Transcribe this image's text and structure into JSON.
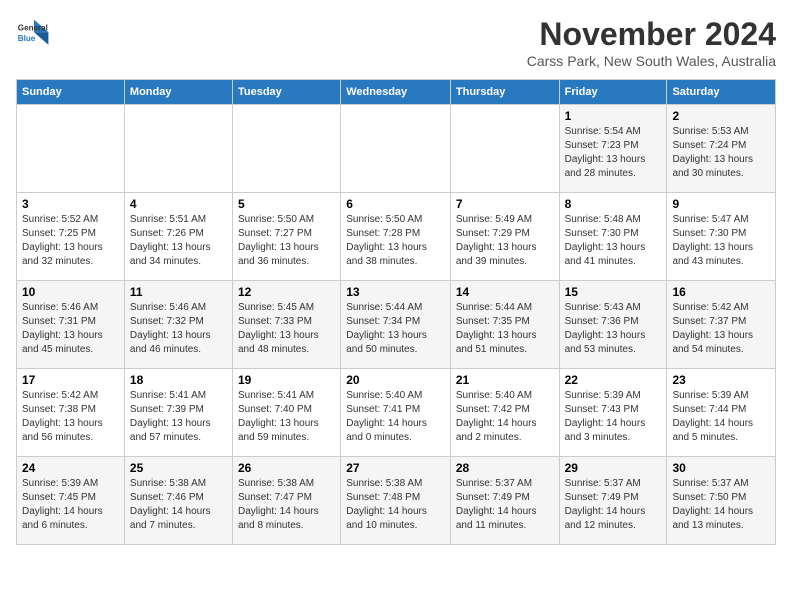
{
  "logo": {
    "line1": "General",
    "line2": "Blue"
  },
  "title": "November 2024",
  "subtitle": "Carss Park, New South Wales, Australia",
  "weekdays": [
    "Sunday",
    "Monday",
    "Tuesday",
    "Wednesday",
    "Thursday",
    "Friday",
    "Saturday"
  ],
  "weeks": [
    [
      {
        "day": "",
        "info": ""
      },
      {
        "day": "",
        "info": ""
      },
      {
        "day": "",
        "info": ""
      },
      {
        "day": "",
        "info": ""
      },
      {
        "day": "",
        "info": ""
      },
      {
        "day": "1",
        "info": "Sunrise: 5:54 AM\nSunset: 7:23 PM\nDaylight: 13 hours\nand 28 minutes."
      },
      {
        "day": "2",
        "info": "Sunrise: 5:53 AM\nSunset: 7:24 PM\nDaylight: 13 hours\nand 30 minutes."
      }
    ],
    [
      {
        "day": "3",
        "info": "Sunrise: 5:52 AM\nSunset: 7:25 PM\nDaylight: 13 hours\nand 32 minutes."
      },
      {
        "day": "4",
        "info": "Sunrise: 5:51 AM\nSunset: 7:26 PM\nDaylight: 13 hours\nand 34 minutes."
      },
      {
        "day": "5",
        "info": "Sunrise: 5:50 AM\nSunset: 7:27 PM\nDaylight: 13 hours\nand 36 minutes."
      },
      {
        "day": "6",
        "info": "Sunrise: 5:50 AM\nSunset: 7:28 PM\nDaylight: 13 hours\nand 38 minutes."
      },
      {
        "day": "7",
        "info": "Sunrise: 5:49 AM\nSunset: 7:29 PM\nDaylight: 13 hours\nand 39 minutes."
      },
      {
        "day": "8",
        "info": "Sunrise: 5:48 AM\nSunset: 7:30 PM\nDaylight: 13 hours\nand 41 minutes."
      },
      {
        "day": "9",
        "info": "Sunrise: 5:47 AM\nSunset: 7:30 PM\nDaylight: 13 hours\nand 43 minutes."
      }
    ],
    [
      {
        "day": "10",
        "info": "Sunrise: 5:46 AM\nSunset: 7:31 PM\nDaylight: 13 hours\nand 45 minutes."
      },
      {
        "day": "11",
        "info": "Sunrise: 5:46 AM\nSunset: 7:32 PM\nDaylight: 13 hours\nand 46 minutes."
      },
      {
        "day": "12",
        "info": "Sunrise: 5:45 AM\nSunset: 7:33 PM\nDaylight: 13 hours\nand 48 minutes."
      },
      {
        "day": "13",
        "info": "Sunrise: 5:44 AM\nSunset: 7:34 PM\nDaylight: 13 hours\nand 50 minutes."
      },
      {
        "day": "14",
        "info": "Sunrise: 5:44 AM\nSunset: 7:35 PM\nDaylight: 13 hours\nand 51 minutes."
      },
      {
        "day": "15",
        "info": "Sunrise: 5:43 AM\nSunset: 7:36 PM\nDaylight: 13 hours\nand 53 minutes."
      },
      {
        "day": "16",
        "info": "Sunrise: 5:42 AM\nSunset: 7:37 PM\nDaylight: 13 hours\nand 54 minutes."
      }
    ],
    [
      {
        "day": "17",
        "info": "Sunrise: 5:42 AM\nSunset: 7:38 PM\nDaylight: 13 hours\nand 56 minutes."
      },
      {
        "day": "18",
        "info": "Sunrise: 5:41 AM\nSunset: 7:39 PM\nDaylight: 13 hours\nand 57 minutes."
      },
      {
        "day": "19",
        "info": "Sunrise: 5:41 AM\nSunset: 7:40 PM\nDaylight: 13 hours\nand 59 minutes."
      },
      {
        "day": "20",
        "info": "Sunrise: 5:40 AM\nSunset: 7:41 PM\nDaylight: 14 hours\nand 0 minutes."
      },
      {
        "day": "21",
        "info": "Sunrise: 5:40 AM\nSunset: 7:42 PM\nDaylight: 14 hours\nand 2 minutes."
      },
      {
        "day": "22",
        "info": "Sunrise: 5:39 AM\nSunset: 7:43 PM\nDaylight: 14 hours\nand 3 minutes."
      },
      {
        "day": "23",
        "info": "Sunrise: 5:39 AM\nSunset: 7:44 PM\nDaylight: 14 hours\nand 5 minutes."
      }
    ],
    [
      {
        "day": "24",
        "info": "Sunrise: 5:39 AM\nSunset: 7:45 PM\nDaylight: 14 hours\nand 6 minutes."
      },
      {
        "day": "25",
        "info": "Sunrise: 5:38 AM\nSunset: 7:46 PM\nDaylight: 14 hours\nand 7 minutes."
      },
      {
        "day": "26",
        "info": "Sunrise: 5:38 AM\nSunset: 7:47 PM\nDaylight: 14 hours\nand 8 minutes."
      },
      {
        "day": "27",
        "info": "Sunrise: 5:38 AM\nSunset: 7:48 PM\nDaylight: 14 hours\nand 10 minutes."
      },
      {
        "day": "28",
        "info": "Sunrise: 5:37 AM\nSunset: 7:49 PM\nDaylight: 14 hours\nand 11 minutes."
      },
      {
        "day": "29",
        "info": "Sunrise: 5:37 AM\nSunset: 7:49 PM\nDaylight: 14 hours\nand 12 minutes."
      },
      {
        "day": "30",
        "info": "Sunrise: 5:37 AM\nSunset: 7:50 PM\nDaylight: 14 hours\nand 13 minutes."
      }
    ]
  ]
}
